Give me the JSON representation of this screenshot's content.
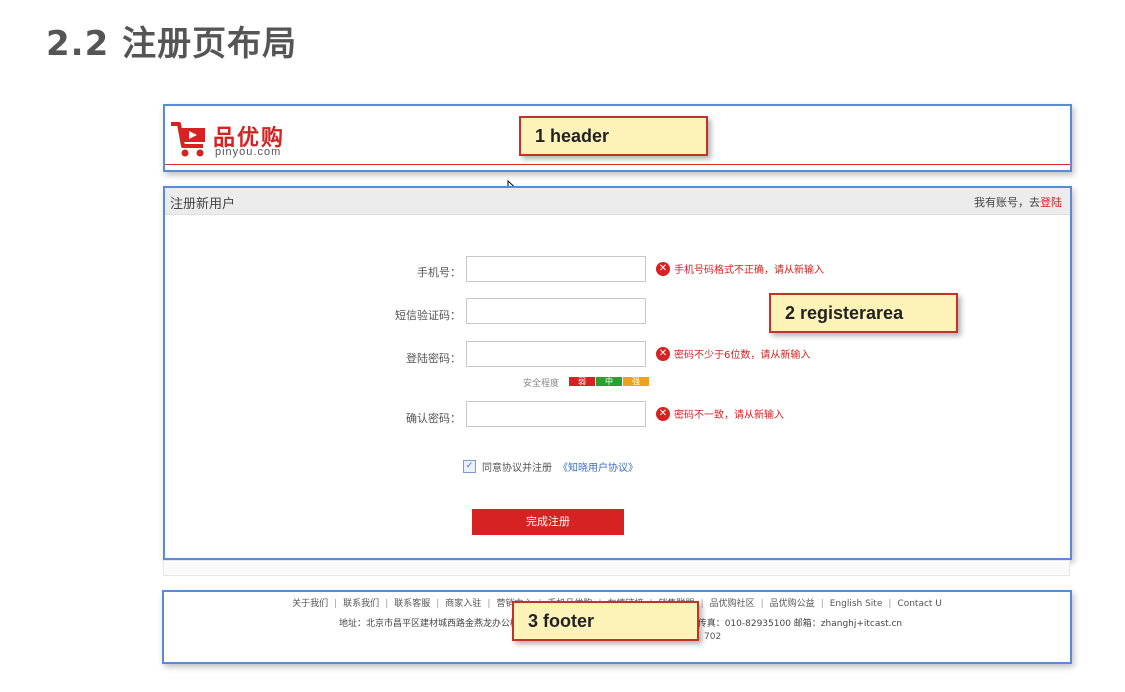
{
  "slide": {
    "title": "2.2 注册页布局"
  },
  "header": {
    "logo_cn": "品优购",
    "logo_en": "pinyou.com",
    "callout": "1  header"
  },
  "register": {
    "title": "注册新用户",
    "login_prefix": "我有账号，去",
    "login_link": "登陆",
    "callout": "2  registerarea",
    "fields": [
      {
        "label": "手机号：",
        "value": "",
        "error": "手机号码格式不正确，请从新输入"
      },
      {
        "label": "短信验证码：",
        "value": "",
        "error": ""
      },
      {
        "label": "登陆密码：",
        "value": "",
        "error": "密码不少于6位数，请从新输入"
      },
      {
        "label": "确认密码：",
        "value": "",
        "error": "密码不一致，请从新输入"
      }
    ],
    "strength": {
      "label": "安全程度",
      "levels": [
        {
          "text": "弱",
          "color": "#d62222"
        },
        {
          "text": "中",
          "color": "#2e9e2e"
        },
        {
          "text": "强",
          "color": "#f0a020"
        }
      ]
    },
    "agree_text": "同意协议并注册",
    "agree_link": "《知晓用户协议》",
    "submit_label": "完成注册"
  },
  "footer": {
    "callout": "3 footer",
    "links": [
      "关于我们",
      "联系我们",
      "联系客服",
      "商家入驻",
      "营销中心",
      "手机品优购",
      "友情链接",
      "销售联盟",
      "品优购社区",
      "品优购公益",
      "English Site",
      "Contact U"
    ],
    "address": "地址：北京市昌平区建材城西路金燕龙办公楼一层  邮编：100096  电话：400-618-4000  传真：010-82935100  邮箱：zhanghj+itcast.cn",
    "extra": "702"
  },
  "colors": {
    "brand_red": "#d62222",
    "frame_blue": "#5b8bd6",
    "callout_fill": "#fdf3b8"
  }
}
